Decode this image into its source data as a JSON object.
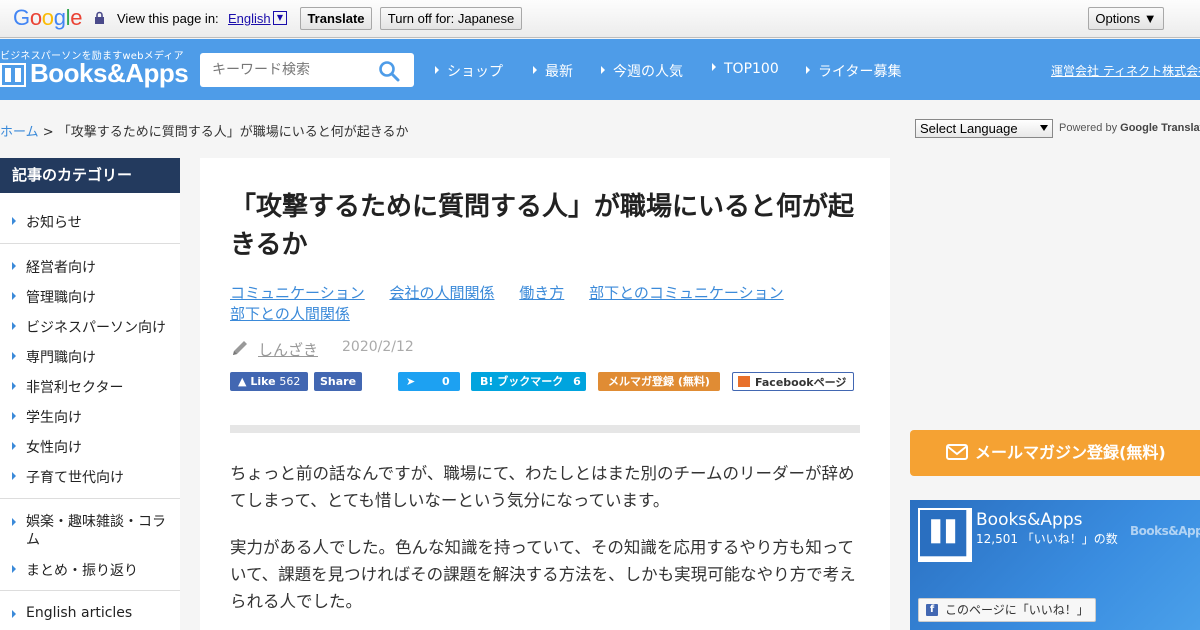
{
  "translate_bar": {
    "logo": "Google",
    "view_label": "View this page in:",
    "language": "English",
    "translate_button": "Translate",
    "turn_off_button": "Turn off for: Japanese",
    "options_button": "Options ▼"
  },
  "header": {
    "tagline": "ビジネスパーソンを励ますwebメディア",
    "logo_text": "Books&Apps",
    "search_placeholder": "キーワード検索",
    "nav": [
      "ショップ",
      "最新",
      "今週の人気",
      "TOP100",
      "ライター募集"
    ],
    "company_link": "運営会社 ティネクト株式会社"
  },
  "breadcrumb": {
    "home": "ホーム",
    "separator": " > ",
    "current": "「攻撃するために質問する人」が職場にいると何が起きるか"
  },
  "translate_widget": {
    "select_label": "Select Language",
    "powered_by": "Powered by",
    "google": "Google",
    "translate": "Translate"
  },
  "sidebar": {
    "heading": "記事のカテゴリー",
    "items": [
      "お知らせ",
      "経営者向け",
      "管理職向け",
      "ビジネスパーソン向け",
      "専門職向け",
      "非営利セクター",
      "学生向け",
      "女性向け",
      "子育て世代向け",
      "娯楽・趣味雑談・コラム",
      "まとめ・振り返り",
      "English articles"
    ]
  },
  "article": {
    "title": "「攻撃するために質問する人」が職場にいると何が起きるか",
    "tags": [
      "コミュニケーション",
      "会社の人間関係",
      "働き方",
      "部下とのコミュニケーション",
      "部下との人間関係"
    ],
    "author": "しんざき",
    "date": "2020/2/12",
    "share": {
      "fb_like_label": "Like",
      "fb_like_count": "562",
      "fb_share_label": "Share",
      "twitter_count": "0",
      "hatena_label": "B! ブックマーク",
      "hatena_count": "6",
      "mailmag_label": "メルマガ登録 (無料)",
      "fbpage_label": "Facebookページ"
    },
    "paragraphs": [
      "ちょっと前の話なんですが、職場にて、わたしとはまた別のチームのリーダーが辞めてしまって、とても惜しいなーという気分になっています。",
      "実力がある人でした。色んな知識を持っていて、その知識を応用するやり方も知っていて、課題を見つければその課題を解決する方法を、しかも実現可能なやり方で考えられる人でした。"
    ]
  },
  "right": {
    "mail_banner": "メールマガジン登録(無料)",
    "fb_widget": {
      "page_name": "Books&Apps",
      "count_text": "12,501 「いいね！」の数",
      "like_button": "このページに「いいね！」"
    }
  }
}
